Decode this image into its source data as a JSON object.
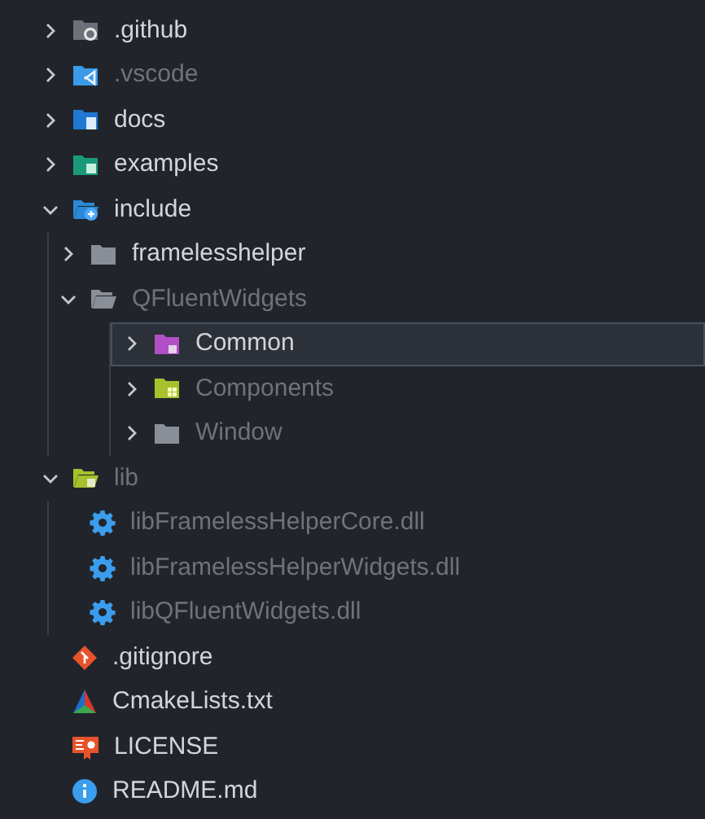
{
  "tree": [
    {
      "label": ".github",
      "kind": "github-folder",
      "dimmed": false,
      "expanded": false,
      "selected": false
    },
    {
      "label": ".vscode",
      "kind": "vscode-folder",
      "dimmed": true,
      "expanded": false,
      "selected": false
    },
    {
      "label": "docs",
      "kind": "docs-folder",
      "dimmed": false,
      "expanded": false,
      "selected": false
    },
    {
      "label": "examples",
      "kind": "examples-folder",
      "dimmed": false,
      "expanded": false,
      "selected": false
    },
    {
      "label": "include",
      "kind": "include-folder",
      "dimmed": false,
      "expanded": true,
      "selected": false,
      "children": [
        {
          "label": "framelesshelper",
          "kind": "folder",
          "dimmed": false,
          "expanded": false,
          "selected": false
        },
        {
          "label": "QFluentWidgets",
          "kind": "folder",
          "dimmed": true,
          "expanded": true,
          "selected": false,
          "children": [
            {
              "label": "Common",
              "kind": "common-folder",
              "dimmed": false,
              "expanded": false,
              "selected": true
            },
            {
              "label": "Components",
              "kind": "components-folder",
              "dimmed": true,
              "expanded": false,
              "selected": false
            },
            {
              "label": "Window",
              "kind": "folder",
              "dimmed": true,
              "expanded": false,
              "selected": false
            }
          ]
        }
      ]
    },
    {
      "label": "lib",
      "kind": "lib-folder",
      "dimmed": true,
      "expanded": true,
      "selected": false,
      "children": [
        {
          "label": "libFramelessHelperCore.dll",
          "kind": "dll",
          "dimmed": true,
          "selected": false
        },
        {
          "label": "libFramelessHelperWidgets.dll",
          "kind": "dll",
          "dimmed": true,
          "selected": false
        },
        {
          "label": "libQFluentWidgets.dll",
          "kind": "dll",
          "dimmed": true,
          "selected": false
        }
      ]
    },
    {
      "label": ".gitignore",
      "kind": "git",
      "dimmed": false,
      "selected": false
    },
    {
      "label": "CmakeLists.txt",
      "kind": "cmake",
      "dimmed": false,
      "selected": false
    },
    {
      "label": "LICENSE",
      "kind": "license",
      "dimmed": false,
      "selected": false
    },
    {
      "label": "README.md",
      "kind": "readme",
      "dimmed": false,
      "selected": false
    }
  ]
}
